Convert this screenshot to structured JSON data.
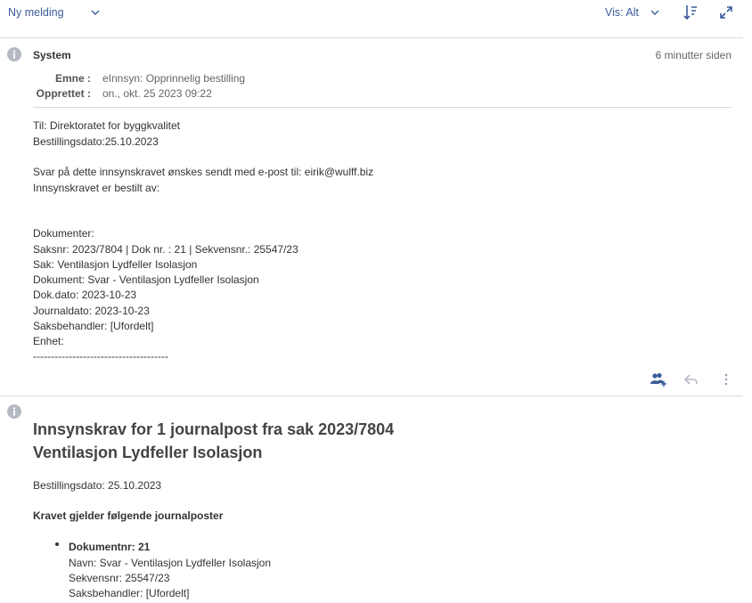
{
  "toolbar": {
    "new_message": "Ny melding",
    "view_label": "Vis: Alt"
  },
  "system_message": {
    "sender": "System",
    "time": "6 minutter siden",
    "subject_label": "Emne :",
    "subject_value": "eInnsyn: Opprinnelig bestilling",
    "created_label": "Opprettet :",
    "created_value": "on., okt. 25 2023 09:22",
    "body_lines": [
      "Til: Direktoratet for byggkvalitet",
      "Bestillingsdato:25.10.2023",
      "",
      "Svar på dette innsynskravet ønskes sendt med e-post til: eirik@wulff.biz",
      "Innsynskravet er bestilt av:",
      "",
      "",
      "Dokumenter:",
      "Saksnr: 2023/7804 | Dok nr. : 21 | Sekvensnr.: 25547/23",
      "Sak: Ventilasjon Lydfeller Isolasjon",
      "Dokument: Svar - Ventilasjon Lydfeller Isolasjon",
      "Dok.dato: 2023-10-23",
      "Journaldato: 2023-10-23",
      "Saksbehandler: [Ufordelt]",
      "Enhet:",
      "--------------------------------------"
    ]
  },
  "second_message": {
    "title_line1": "Innsynskrav for 1 journalpost fra sak 2023/7804",
    "title_line2": "Ventilasjon Lydfeller Isolasjon",
    "order_date": "Bestillingsdato: 25.10.2023",
    "claim_heading": "Kravet gjelder følgende journalposter",
    "doc_number": "Dokumentnr: 21",
    "doc_name": "Navn: Svar - Ventilasjon Lydfeller Isolasjon",
    "doc_seq": "Sekvensnr: 25547/23",
    "doc_handler": "Saksbehandler: [Ufordelt]"
  },
  "icons": {
    "accent": "#3b5b9a",
    "gray": "#9aa3b5"
  }
}
